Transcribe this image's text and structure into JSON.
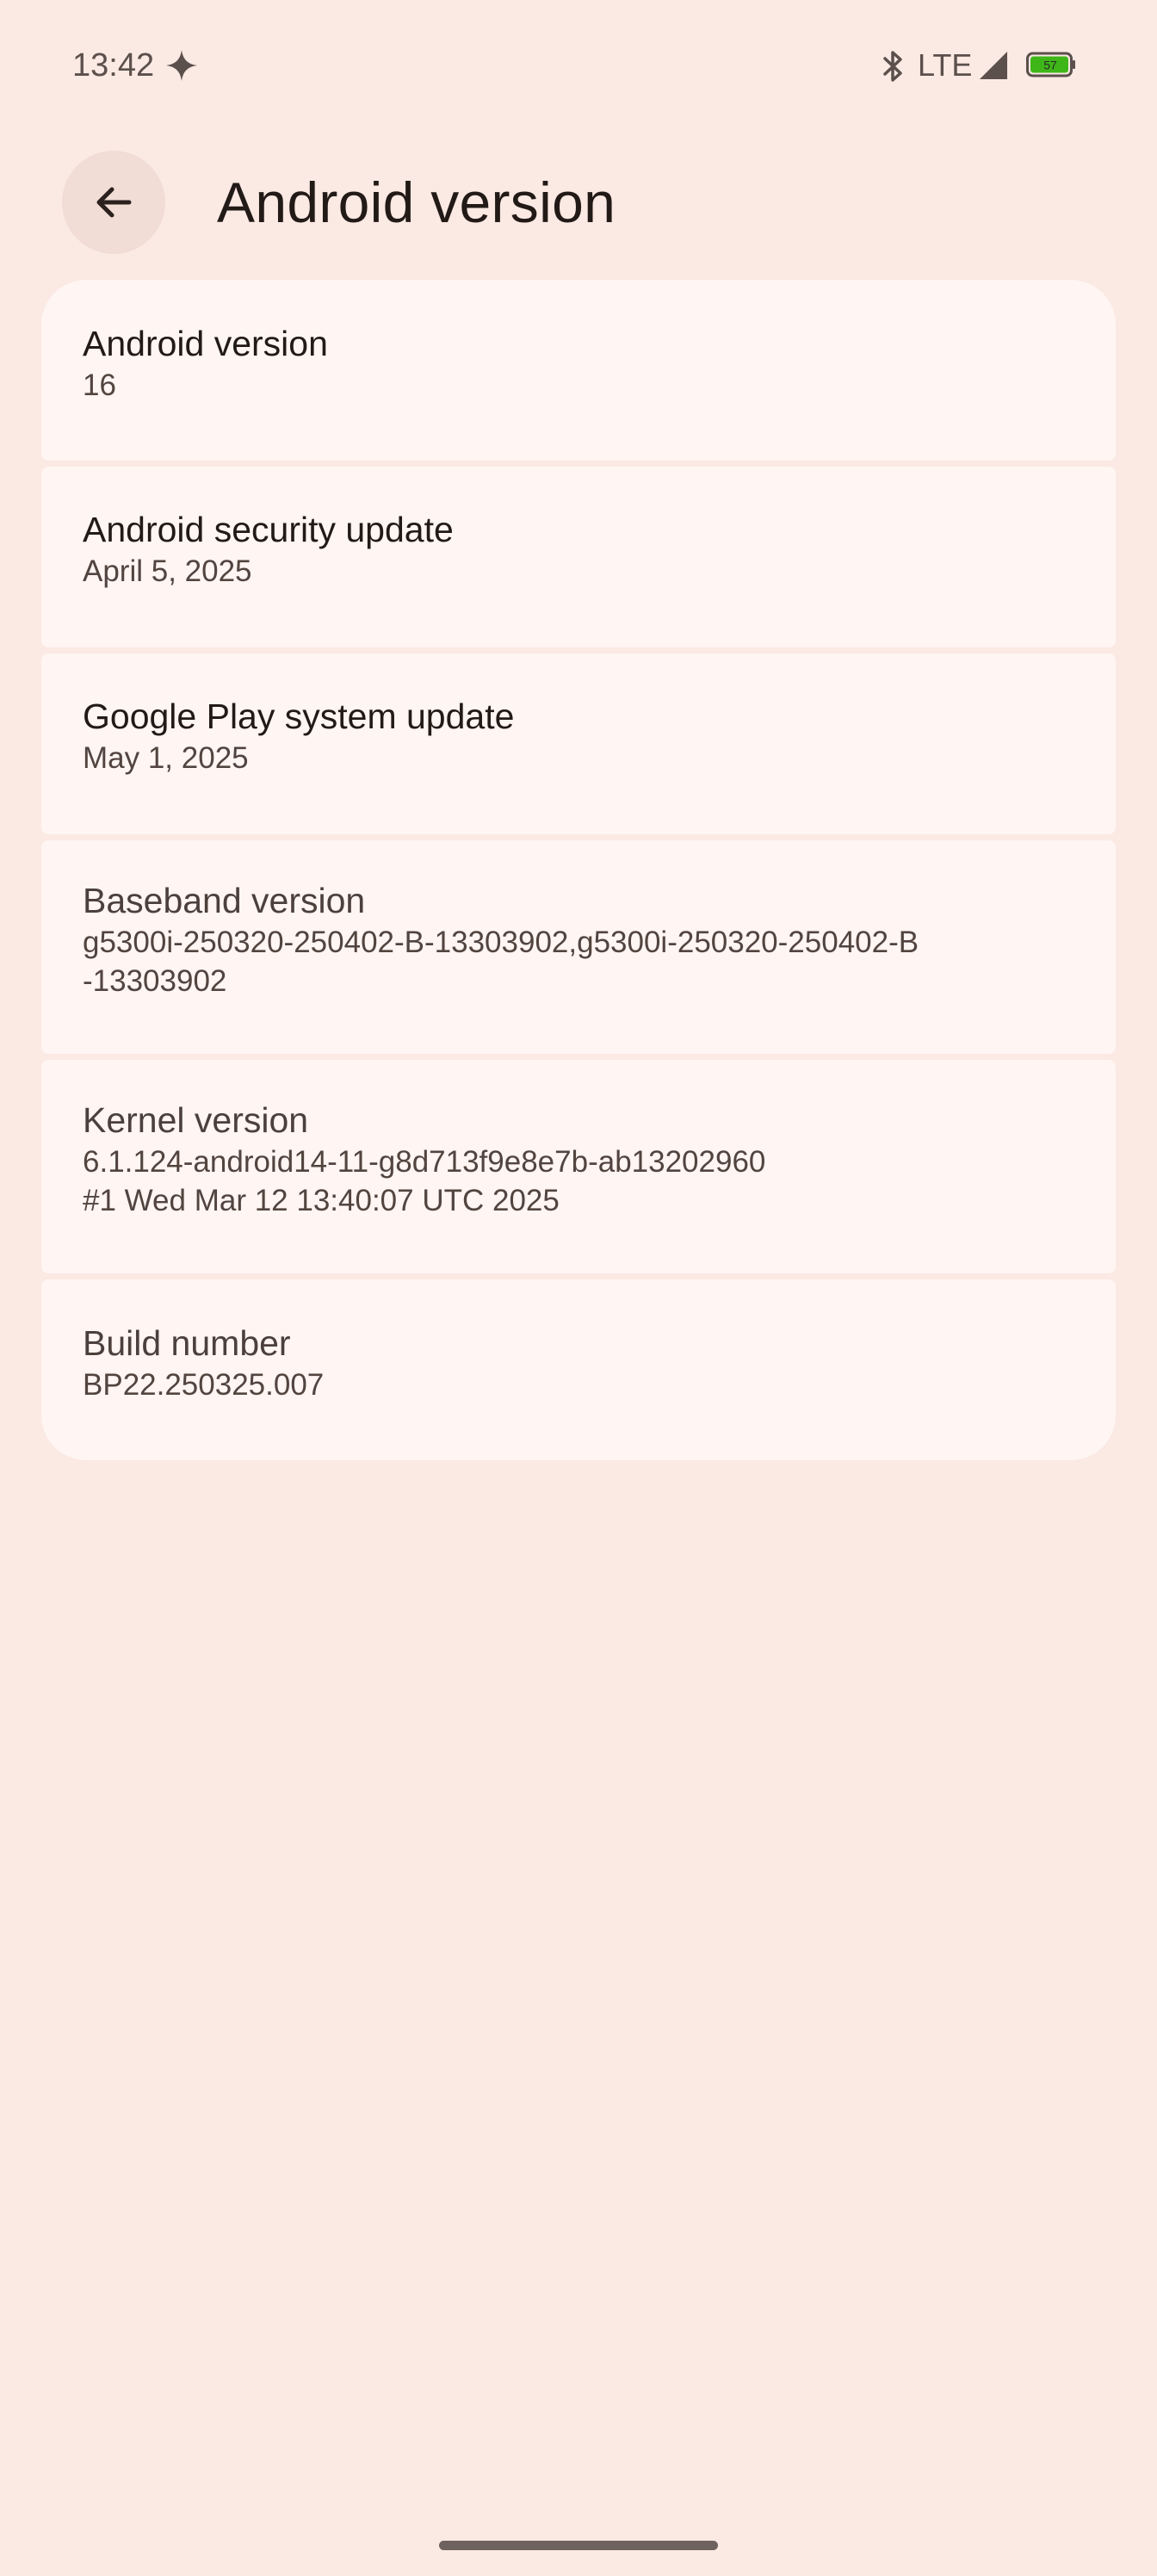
{
  "status_bar": {
    "time": "13:42",
    "network": "LTE",
    "battery_level": "57",
    "icons": [
      "sparkle-icon",
      "bluetooth-icon",
      "signal-icon",
      "battery-icon"
    ]
  },
  "app_bar": {
    "back_icon": "arrow-back-icon",
    "title": "Android version"
  },
  "items": [
    {
      "title": "Android version",
      "value": "16"
    },
    {
      "title": "Android security update",
      "value": "April 5, 2025"
    },
    {
      "title": "Google Play system update",
      "value": "May 1, 2025"
    },
    {
      "title": "Baseband version",
      "value": "g5300i-250320-250402-B-13303902,g5300i-250320-250402-B\n-13303902"
    },
    {
      "title": "Kernel version",
      "value": "6.1.124-android14-11-g8d713f9e8e7b-ab13202960\n#1 Wed Mar 12 13:40:07 UTC 2025"
    },
    {
      "title": "Build number",
      "value": "BP22.250325.007"
    }
  ],
  "colors": {
    "background": "#fbe9e3",
    "card": "#fff5f2",
    "back_button": "#f1ddd6",
    "battery_fill": "#3fb618"
  }
}
